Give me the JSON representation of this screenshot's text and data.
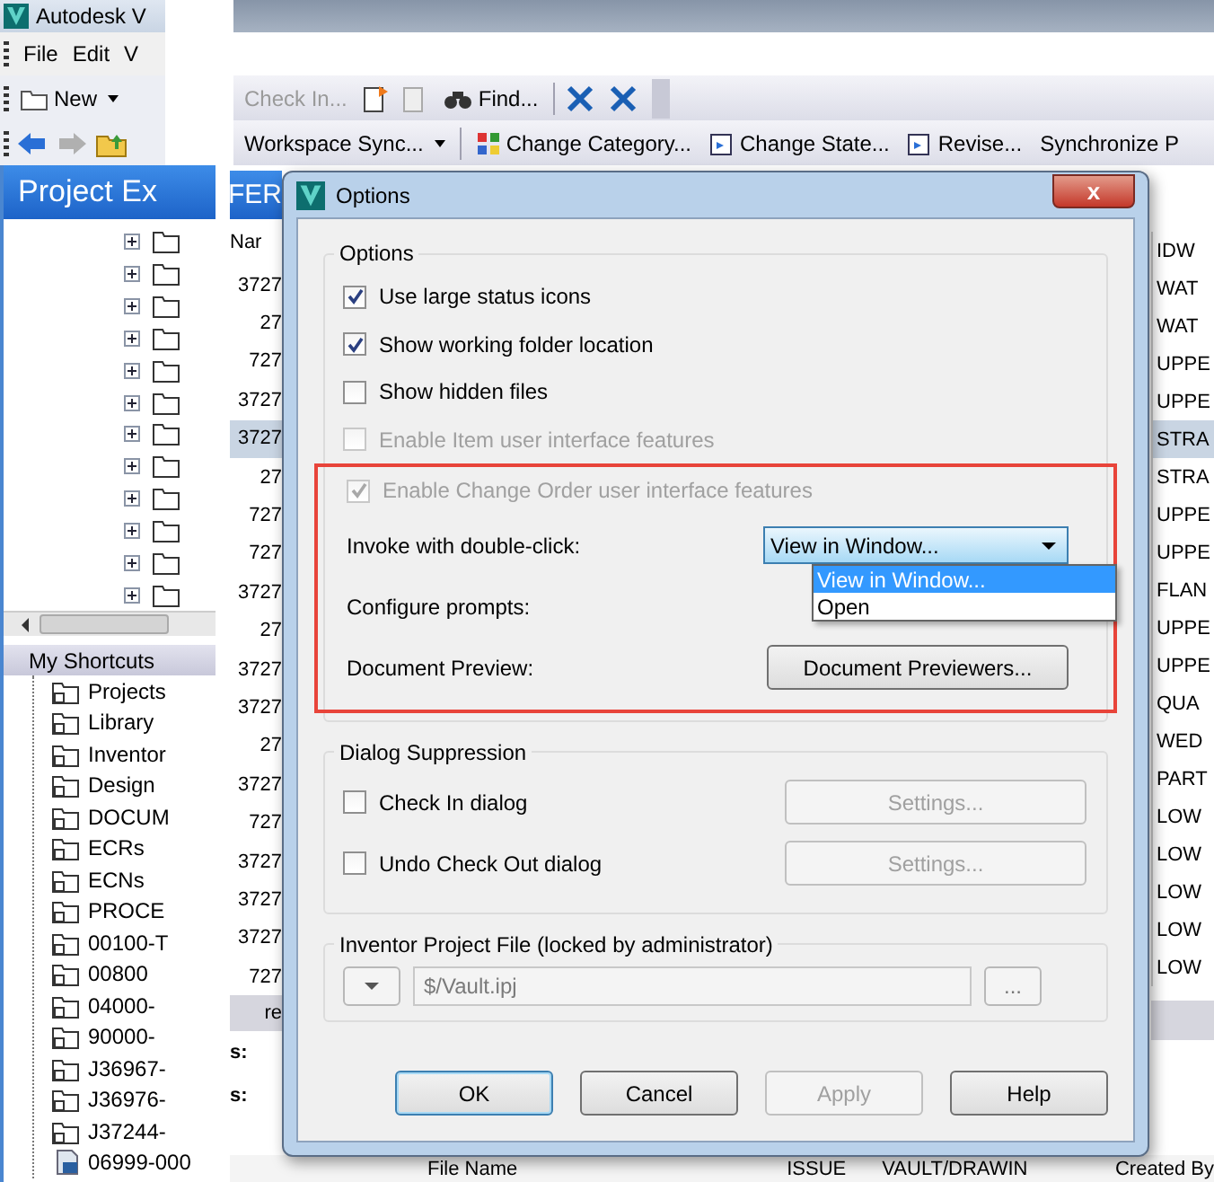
{
  "app": {
    "title": "Autodesk V",
    "menu": [
      "File",
      "Edit",
      "V"
    ]
  },
  "toolbar_1": {
    "new": "New",
    "check_in": {
      "label": "Check In...",
      "disabled": true
    },
    "find": "Find..."
  },
  "toolbar_2": [
    "Workspace Sync...",
    "Change Category...",
    "Change State...",
    "Revise...",
    "Synchronize P"
  ],
  "project_explorer": {
    "title": "Project Ex",
    "nodes": [
      {
        "expanded": false
      },
      {
        "expanded": false
      },
      {
        "expanded": false
      },
      {
        "expanded": false
      },
      {
        "expanded": false
      },
      {
        "expanded": false
      },
      {
        "expanded": false
      },
      {
        "expanded": false
      },
      {
        "expanded": false
      },
      {
        "expanded": false
      },
      {
        "expanded": false
      },
      {
        "expanded": false
      }
    ]
  },
  "shortcuts": {
    "title": "My Shortcuts",
    "items": [
      {
        "kind": "folder",
        "label": "Projects"
      },
      {
        "kind": "folder",
        "label": "Library"
      },
      {
        "kind": "folder",
        "label": "Inventor"
      },
      {
        "kind": "folder",
        "label": "Design"
      },
      {
        "kind": "folder",
        "label": "DOCUM"
      },
      {
        "kind": "folder",
        "label": "ECRs"
      },
      {
        "kind": "folder",
        "label": "ECNs"
      },
      {
        "kind": "folder",
        "label": "PROCE"
      },
      {
        "kind": "folder",
        "label": "00100-T"
      },
      {
        "kind": "folder",
        "label": "00800"
      },
      {
        "kind": "folder",
        "label": "04000-"
      },
      {
        "kind": "folder",
        "label": "90000-"
      },
      {
        "kind": "folder",
        "label": "J36967-"
      },
      {
        "kind": "folder",
        "label": "J36976-"
      },
      {
        "kind": "folder",
        "label": "J37244-"
      },
      {
        "kind": "file",
        "label": "06999-000"
      }
    ]
  },
  "file_list": {
    "title": "FER",
    "column_1_header": "Nar",
    "column_1": [
      {
        "text": "3727",
        "selected": false
      },
      {
        "text": "27",
        "selected": false
      },
      {
        "text": "727",
        "selected": false
      },
      {
        "text": "3727",
        "selected": false
      },
      {
        "text": "3727",
        "selected": true
      },
      {
        "text": "27",
        "selected": false
      },
      {
        "text": "727",
        "selected": false
      },
      {
        "text": "727",
        "selected": false
      },
      {
        "text": "3727",
        "selected": false
      },
      {
        "text": "27",
        "selected": false
      },
      {
        "text": "3727",
        "selected": false
      },
      {
        "text": "3727",
        "selected": false
      },
      {
        "text": "27",
        "selected": false
      },
      {
        "text": "3727",
        "selected": false
      },
      {
        "text": "727",
        "selected": false
      },
      {
        "text": "3727",
        "selected": false
      },
      {
        "text": "3727",
        "selected": false
      },
      {
        "text": "3727",
        "selected": false
      },
      {
        "text": "727",
        "selected": false
      }
    ],
    "column_2": [
      {
        "text": "IDW",
        "selected": false
      },
      {
        "text": "WAT",
        "selected": false
      },
      {
        "text": "WAT",
        "selected": false
      },
      {
        "text": "UPPE",
        "selected": false
      },
      {
        "text": "UPPE",
        "selected": false
      },
      {
        "text": "STRA",
        "selected": true
      },
      {
        "text": "STRA",
        "selected": false
      },
      {
        "text": "UPPE",
        "selected": false
      },
      {
        "text": "UPPE",
        "selected": false
      },
      {
        "text": "FLAN",
        "selected": false
      },
      {
        "text": "UPPE",
        "selected": false
      },
      {
        "text": "UPPE",
        "selected": false
      },
      {
        "text": "QUA",
        "selected": false
      },
      {
        "text": "WED",
        "selected": false
      },
      {
        "text": "PART",
        "selected": false
      },
      {
        "text": "LOW",
        "selected": false
      },
      {
        "text": "LOW",
        "selected": false
      },
      {
        "text": "LOW",
        "selected": false
      },
      {
        "text": "LOW",
        "selected": false
      },
      {
        "text": "LOW",
        "selected": false
      }
    ],
    "details_tab": "re",
    "details_labels": [
      "s:",
      "s:"
    ],
    "footer_columns": [
      "File Name",
      "ISSUE",
      "VAULT/DRAWIN",
      "Created By"
    ]
  },
  "dialog": {
    "title": "Options",
    "close": "x",
    "options_group": {
      "title": "Options",
      "checkboxes": [
        {
          "label": "Use large status icons",
          "checked": true,
          "disabled": false
        },
        {
          "label": "Show working folder location",
          "checked": true,
          "disabled": false
        },
        {
          "label": "Show hidden files",
          "checked": false,
          "disabled": false
        },
        {
          "label": "Enable Item user interface features",
          "checked": false,
          "disabled": true
        },
        {
          "label": "Enable Change Order user interface features",
          "checked": true,
          "disabled": true
        }
      ],
      "invoke_label": "Invoke with double-click:",
      "invoke_value": "View in Window...",
      "invoke_options": [
        {
          "label": "View in Window...",
          "selected": true
        },
        {
          "label": "Open",
          "selected": false
        }
      ],
      "configure_label": "Configure prompts:",
      "preview_label": "Document Preview:",
      "preview_button": "Document Previewers..."
    },
    "suppression_group": {
      "title": "Dialog Suppression",
      "rows": [
        {
          "label": "Check In dialog",
          "checked": false,
          "button": "Settings...",
          "button_disabled": true
        },
        {
          "label": "Undo Check Out dialog",
          "checked": false,
          "button": "Settings...",
          "button_disabled": true
        }
      ]
    },
    "project_group": {
      "title": "Inventor Project File (locked by administrator)",
      "value": "$/Vault.ipj",
      "browse": "..."
    },
    "buttons": [
      {
        "label": "OK",
        "default": true,
        "disabled": false
      },
      {
        "label": "Cancel",
        "default": false,
        "disabled": false
      },
      {
        "label": "Apply",
        "default": false,
        "disabled": true
      },
      {
        "label": "Help",
        "default": false,
        "disabled": false
      }
    ]
  }
}
